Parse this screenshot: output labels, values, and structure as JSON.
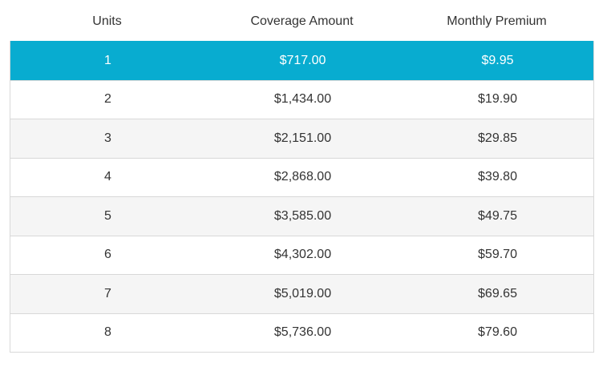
{
  "table": {
    "headers": [
      "Units",
      "Coverage Amount",
      "Monthly Premium"
    ],
    "rows": [
      {
        "units": "1",
        "coverage": "$717.00",
        "premium": "$9.95"
      },
      {
        "units": "2",
        "coverage": "$1,434.00",
        "premium": "$19.90"
      },
      {
        "units": "3",
        "coverage": "$2,151.00",
        "premium": "$29.85"
      },
      {
        "units": "4",
        "coverage": "$2,868.00",
        "premium": "$39.80"
      },
      {
        "units": "5",
        "coverage": "$3,585.00",
        "premium": "$49.75"
      },
      {
        "units": "6",
        "coverage": "$4,302.00",
        "premium": "$59.70"
      },
      {
        "units": "7",
        "coverage": "$5,019.00",
        "premium": "$69.65"
      },
      {
        "units": "8",
        "coverage": "$5,736.00",
        "premium": "$79.60"
      }
    ]
  },
  "colors": {
    "selected_row": "#08acd0",
    "selected_text": "#ffffff",
    "alt_row": "#f5f5f5",
    "border": "#d8d8d8",
    "text": "#333333"
  }
}
